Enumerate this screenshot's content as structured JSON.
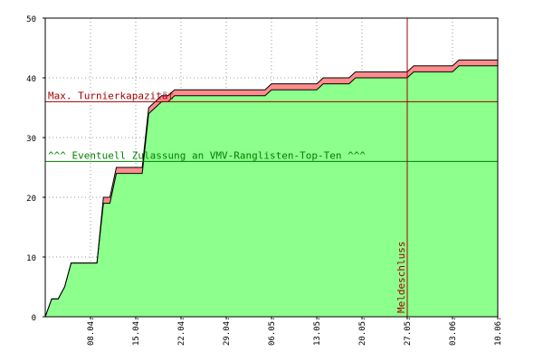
{
  "colors": {
    "background": "#ffffff",
    "plot_border": "#000000",
    "grid": "#999999",
    "area_fill": "#8cff8c",
    "band_fill": "#ff8c8c",
    "line": "#000000",
    "capacity_line": "#a00000",
    "ranking_line": "#008000",
    "deadline_line": "#a00000"
  },
  "chart_data": {
    "type": "area",
    "title": "",
    "xlabel": "",
    "ylabel": "",
    "ylim": [
      0,
      50
    ],
    "yticks": [
      0,
      10,
      20,
      30,
      40,
      50
    ],
    "xlim": [
      "2000-04-01",
      "2000-06-10"
    ],
    "xticks": [
      "08.04.",
      "15.04.",
      "22.04.",
      "29.04.",
      "06.05.",
      "13.05.",
      "20.05.",
      "27.05.",
      "03.06.",
      "10.06."
    ],
    "xtick_dates": [
      "2000-04-08",
      "2000-04-15",
      "2000-04-22",
      "2000-04-29",
      "2000-05-06",
      "2000-05-13",
      "2000-05-20",
      "2000-05-27",
      "2000-06-03",
      "2000-06-10"
    ],
    "grid": true,
    "series": [
      {
        "values_lower": [
          [
            "2000-04-01",
            0
          ],
          [
            "2000-04-02",
            3
          ],
          [
            "2000-04-03",
            3
          ],
          [
            "2000-04-04",
            5
          ],
          [
            "2000-04-05",
            9
          ],
          [
            "2000-04-09",
            9
          ],
          [
            "2000-04-10",
            19
          ],
          [
            "2000-04-11",
            19
          ],
          [
            "2000-04-12",
            24
          ],
          [
            "2000-04-16",
            24
          ],
          [
            "2000-04-17",
            34
          ],
          [
            "2000-04-18",
            35
          ],
          [
            "2000-04-19",
            36
          ],
          [
            "2000-04-20",
            36
          ],
          [
            "2000-04-21",
            37
          ],
          [
            "2000-05-05",
            37
          ],
          [
            "2000-05-06",
            38
          ],
          [
            "2000-05-13",
            38
          ],
          [
            "2000-05-14",
            39
          ],
          [
            "2000-05-18",
            39
          ],
          [
            "2000-05-19",
            40
          ],
          [
            "2000-05-27",
            40
          ],
          [
            "2000-05-28",
            41
          ],
          [
            "2000-06-03",
            41
          ],
          [
            "2000-06-04",
            42
          ],
          [
            "2000-06-10",
            42
          ]
        ],
        "values_upper": [
          [
            "2000-04-01",
            0
          ],
          [
            "2000-04-02",
            3
          ],
          [
            "2000-04-03",
            3
          ],
          [
            "2000-04-04",
            5
          ],
          [
            "2000-04-05",
            9
          ],
          [
            "2000-04-09",
            9
          ],
          [
            "2000-04-10",
            20
          ],
          [
            "2000-04-11",
            20
          ],
          [
            "2000-04-12",
            25
          ],
          [
            "2000-04-16",
            25
          ],
          [
            "2000-04-17",
            35
          ],
          [
            "2000-04-18",
            36
          ],
          [
            "2000-04-19",
            37
          ],
          [
            "2000-04-20",
            37
          ],
          [
            "2000-04-21",
            38
          ],
          [
            "2000-05-05",
            38
          ],
          [
            "2000-05-06",
            39
          ],
          [
            "2000-05-13",
            39
          ],
          [
            "2000-05-14",
            40
          ],
          [
            "2000-05-18",
            40
          ],
          [
            "2000-05-19",
            41
          ],
          [
            "2000-05-27",
            41
          ],
          [
            "2000-05-28",
            42
          ],
          [
            "2000-06-03",
            42
          ],
          [
            "2000-06-04",
            43
          ],
          [
            "2000-06-10",
            43
          ]
        ]
      }
    ],
    "annotations": [
      {
        "type": "hline",
        "y": 36,
        "label": "Max. Turnierkapazität"
      },
      {
        "type": "hline",
        "y": 26,
        "label": "^^^ Eventuell Zulassung an VMV-Ranglisten-Top-Ten ^^^"
      },
      {
        "type": "vline",
        "x": "2000-05-27",
        "label": "Meldeschluss"
      }
    ]
  }
}
